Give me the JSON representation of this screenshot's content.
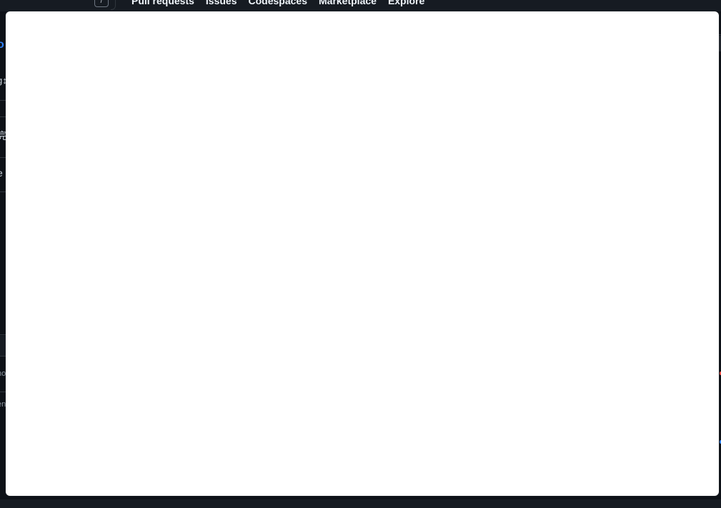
{
  "header": {
    "search_shortcut": "/",
    "nav_links": [
      "Pull requests",
      "Issues",
      "Codespaces",
      "Marketplace",
      "Explore"
    ]
  },
  "background_fragments": {
    "blue_fragment": "o",
    "fragment_2": "g↕",
    "fragment_3": "完",
    "fragment_4": "e",
    "fragment_5": "no",
    "fragment_6": "en"
  },
  "colors": {
    "background": "#0d1117",
    "header": "#161b22",
    "modal": "#ffffff",
    "accent": "#2f81f7"
  }
}
